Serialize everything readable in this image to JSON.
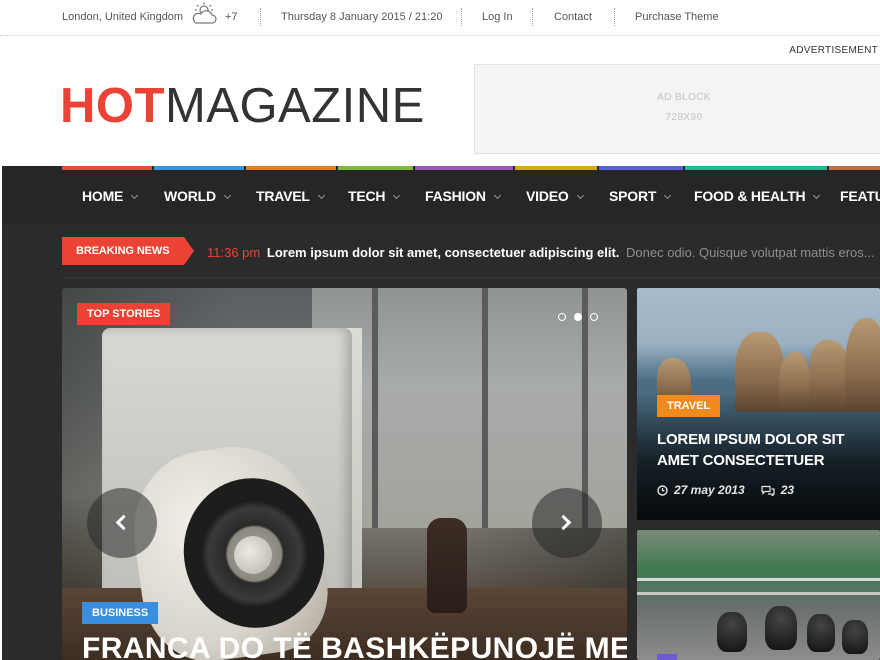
{
  "topbar": {
    "location": "London, United Kingdom",
    "weather_icon": "partly-cloudy-icon",
    "temperature": "+7",
    "datetime": "Thursday 8 January 2015 / 21:20",
    "login": "Log In",
    "contact": "Contact",
    "purchase": "Purchase Theme"
  },
  "header": {
    "advertisement_label": "ADVERTISEMENT",
    "logo_hot": "HOT",
    "logo_magazine": "MAGAZINE",
    "adblock_title": "AD BLOCK",
    "adblock_size": "728X90"
  },
  "nav": {
    "items": [
      {
        "label": "HOME",
        "color": "#e74c3c"
      },
      {
        "label": "WORLD",
        "color": "#3498db"
      },
      {
        "label": "TRAVEL",
        "color": "#e67e22"
      },
      {
        "label": "TECH",
        "color": "#7fba3c"
      },
      {
        "label": "FASHION",
        "color": "#9b59b6"
      },
      {
        "label": "VIDEO",
        "color": "#d4ac0d"
      },
      {
        "label": "SPORT",
        "color": "#5b5fd6"
      },
      {
        "label": "FOOD & HEALTH",
        "color": "#1abc9c"
      },
      {
        "label": "FEATU",
        "color": "#c0703a"
      }
    ]
  },
  "breaking": {
    "label": "BREAKING NEWS",
    "time": "11:36 pm",
    "headline": "Lorem ipsum dolor sit amet, consectetuer adipiscing elit.",
    "summary": "Donec odio. Quisque volutpat mattis eros..."
  },
  "slider": {
    "badge": "TOP STORIES",
    "category": "BUSINESS",
    "title": "FRANCA DO TË BASHKËPUNOJË ME",
    "dots": 3,
    "active_dot": 2
  },
  "cards": [
    {
      "category": "TRAVEL",
      "title": "LOREM IPSUM DOLOR SIT AMET CONSECTETUER",
      "date": "27 may 2013",
      "comments": "23"
    },
    {
      "category": ""
    }
  ],
  "colors": {
    "accent": "#ea4335",
    "dark_bg": "#2b2b2b",
    "tag_blue": "#3a8ee0",
    "tag_orange": "#f18a1c"
  }
}
